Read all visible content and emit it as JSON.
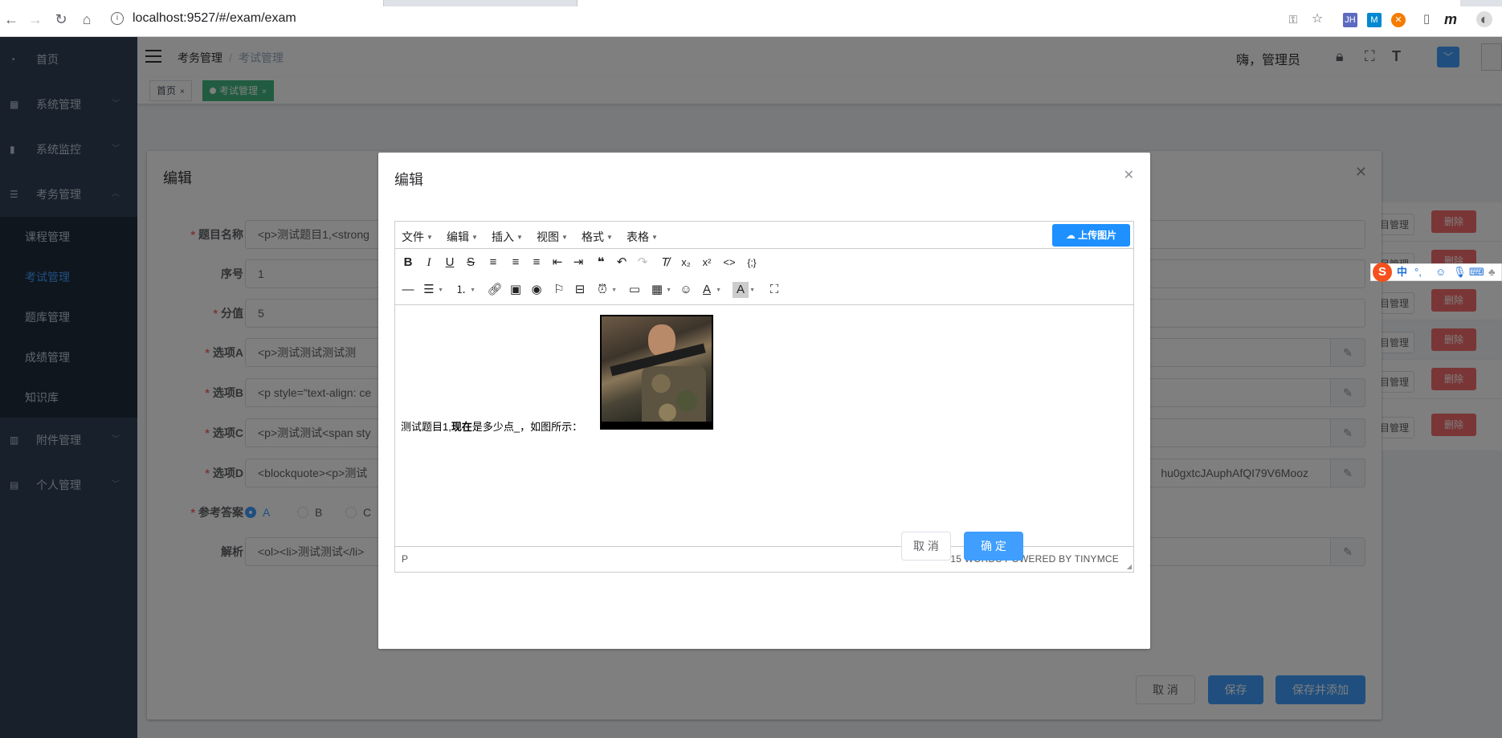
{
  "browser": {
    "url": "localhost:9527/#/exam/exam"
  },
  "sidebar": {
    "items": [
      {
        "label": "首页",
        "icon": "dashboard-icon"
      },
      {
        "label": "系统管理",
        "icon": "grid-icon"
      },
      {
        "label": "系统监控",
        "icon": "bar-chart-icon"
      },
      {
        "label": "考务管理",
        "icon": "list-icon"
      }
    ],
    "sub_items": [
      "课程管理",
      "考试管理",
      "题库管理",
      "成绩管理",
      "知识库"
    ],
    "items_after": [
      {
        "label": "附件管理",
        "icon": "book-icon"
      },
      {
        "label": "个人管理",
        "icon": "document-icon"
      }
    ]
  },
  "navbar": {
    "breadcrumb_root": "考务管理",
    "breadcrumb_current": "考试管理",
    "greeting": "嗨，管理员"
  },
  "tags": {
    "home": "首页",
    "current": "考试管理"
  },
  "bg_table": {
    "manage_label": "目管理",
    "delete_label": "删除"
  },
  "outer_dialog": {
    "title": "编辑",
    "fields": {
      "name_label": "题目名称",
      "name_value": "<p>测试题目1,<strong",
      "seq_label": "序号",
      "seq_value": "1",
      "score_label": "分值",
      "score_value": "5",
      "a_label": "选项A",
      "a_value": "<p>测试测试测试测",
      "b_label": "选项B",
      "b_value": "<p style=\"text-align: ce",
      "c_label": "选项C",
      "c_value": "<p>测试测试<span sty",
      "d_label": "选项D",
      "d_value": "<blockquote><p>测试",
      "d_tail": "hu0gxtcJAuphAfQI79V6Mooz",
      "answer_label": "参考答案",
      "answer_options": [
        "A",
        "B",
        "C"
      ],
      "analysis_label": "解析",
      "analysis_value": "<ol><li>测试测试</li>"
    },
    "buttons": {
      "cancel": "取 消",
      "save": "保存",
      "save_add": "保存并添加"
    }
  },
  "inner_dialog": {
    "title": "编辑",
    "menus": [
      "文件",
      "编辑",
      "插入",
      "视图",
      "格式",
      "表格"
    ],
    "upload_label": "上传图片",
    "content_text_prefix": "测试题目1,",
    "content_text_bold": "现在",
    "content_text_suffix": "是多少点_，如图所示：",
    "status_path": "P",
    "status_words": "15 WORDS POWERED BY TINYMCE",
    "cancel": "取 消",
    "confirm": "确 定"
  },
  "ime": {
    "lang": "中"
  },
  "colors": {
    "sidebar_bg": "#304156",
    "accent": "#409eff",
    "tag_active": "#42b983",
    "danger": "#f56c6c",
    "upload_btn": "#1e90ff"
  }
}
